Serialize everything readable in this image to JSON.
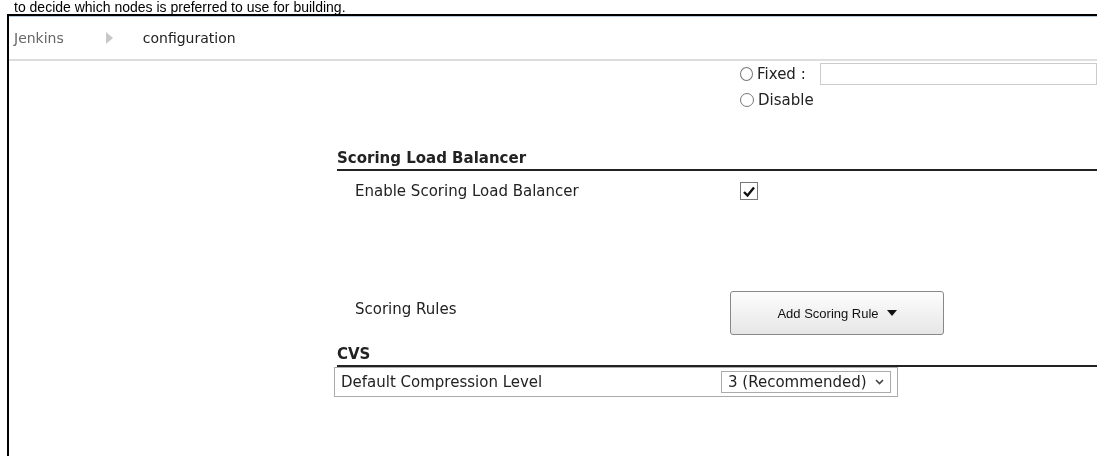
{
  "intro_text": "to decide which nodes is preferred to use for building.",
  "breadcrumbs": [
    {
      "label": "Jenkins"
    },
    {
      "label": "configuration"
    }
  ],
  "radio_options": [
    {
      "label": "Fixed :",
      "selected": false,
      "kind": "with_field"
    },
    {
      "label": "Disable",
      "selected": false,
      "kind": "plain"
    }
  ],
  "sections": [
    {
      "title": "Scoring Load Balancer",
      "rows": [
        {
          "kind": "checkbox",
          "label": "Enable Scoring Load Balancer",
          "checked": true
        },
        {
          "kind": "dropdown_button",
          "label": "Scoring Rules",
          "button": "Add Scoring Rule"
        }
      ]
    },
    {
      "title": "CVS",
      "rows": [
        {
          "kind": "select",
          "label": "Default Compression Level",
          "value": "3 (Recommended)"
        }
      ]
    }
  ]
}
